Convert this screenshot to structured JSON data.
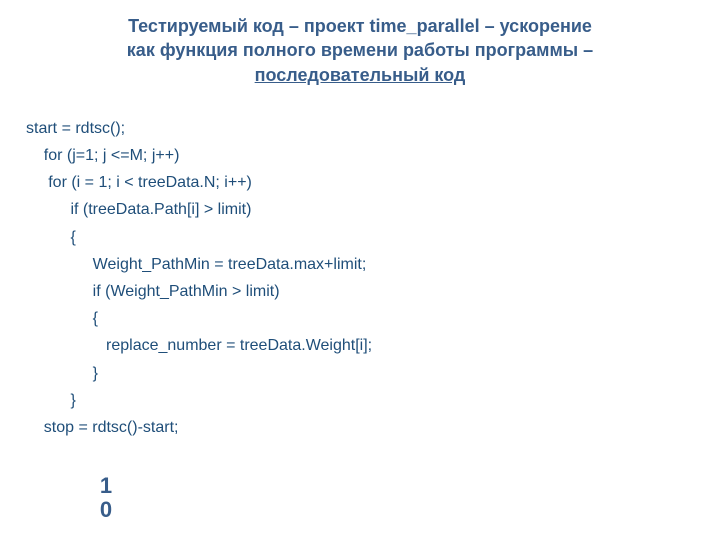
{
  "title": {
    "line1": "Тестируемый код – проект time_parallel – ускорение",
    "line2": "как функция полного времени работы программы –",
    "line3": "последовательный код"
  },
  "code": {
    "l1": "start = rdtsc();",
    "l2": "    for (j=1; j <=M; j++)",
    "l3": "     for (i = 1; i < treeData.N; i++)",
    "l4": "          if (treeData.Path[i] > limit)",
    "l5": "          {",
    "l6": "               Weight_PathMin = treeData.max+limit;",
    "l7": "               if (Weight_PathMin > limit)",
    "l8": "               {",
    "l9": "                  replace_number = treeData.Weight[i];",
    "l10": "               }",
    "l11": "          }",
    "l12": "    stop = rdtsc()-start;"
  },
  "page_number": "10"
}
